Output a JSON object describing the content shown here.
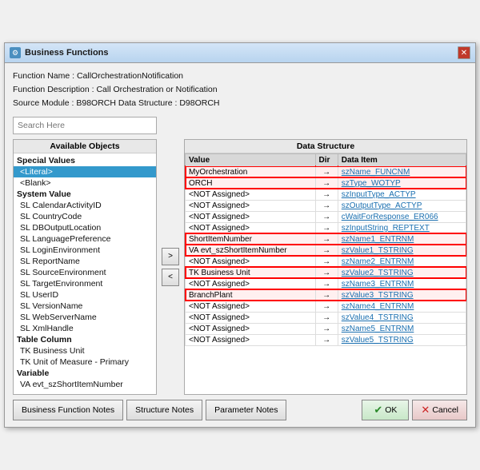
{
  "window": {
    "title": "Business Functions",
    "close_label": "✕"
  },
  "info": {
    "function_name_label": "Function Name : CallOrchestrationNotification",
    "function_desc_label": "Function Description : Call Orchestration or Notification",
    "source_module_label": "Source Module : B98ORCH    Data Structure : D98ORCH"
  },
  "search": {
    "placeholder": "Search Here"
  },
  "available_objects": {
    "header": "Available Objects",
    "sections": [
      {
        "label": "Special Values",
        "items": [
          {
            "text": "<Literal>",
            "selected": true
          },
          {
            "text": "<Blank>",
            "selected": false
          }
        ]
      },
      {
        "label": "System Value",
        "items": [
          {
            "text": "SL  CalendarActivityID",
            "selected": false
          },
          {
            "text": "SL  CountryCode",
            "selected": false
          },
          {
            "text": "SL  DBOutputLocation",
            "selected": false
          },
          {
            "text": "SL  LanguagePreference",
            "selected": false
          },
          {
            "text": "SL  LoginEnvironment",
            "selected": false
          },
          {
            "text": "SL  ReportName",
            "selected": false
          },
          {
            "text": "SL  SourceEnvironment",
            "selected": false
          },
          {
            "text": "SL  TargetEnvironment",
            "selected": false
          },
          {
            "text": "SL  UserID",
            "selected": false
          },
          {
            "text": "SL  VersionName",
            "selected": false
          },
          {
            "text": "SL  WebServerName",
            "selected": false
          },
          {
            "text": "SL  XmlHandle",
            "selected": false
          }
        ]
      },
      {
        "label": "Table Column",
        "items": [
          {
            "text": "TK  Business Unit",
            "selected": false
          },
          {
            "text": "TK  Unit of Measure - Primary",
            "selected": false
          }
        ]
      },
      {
        "label": "Variable",
        "items": [
          {
            "text": "VA  evt_szShortItemNumber",
            "selected": false
          }
        ]
      }
    ]
  },
  "middle_buttons": {
    "right_arrow": ">",
    "left_arrow": "<"
  },
  "data_structure": {
    "header": "Data Structure",
    "columns": [
      "Value",
      "Dir",
      "Data Item"
    ],
    "rows": [
      {
        "value": "MyOrchestration",
        "dir": "→",
        "data_item": "szName_FUNCNM",
        "highlighted": true
      },
      {
        "value": "ORCH",
        "dir": "→",
        "data_item": "szType_WOTYP",
        "highlighted": true
      },
      {
        "value": "<NOT Assigned>",
        "dir": "→",
        "data_item": "szInputType_ACTYP",
        "highlighted": false
      },
      {
        "value": "<NOT Assigned>",
        "dir": "→",
        "data_item": "szOutputType_ACTYP",
        "highlighted": false
      },
      {
        "value": "<NOT Assigned>",
        "dir": "→",
        "data_item": "cWaitForResponse_ER066",
        "highlighted": false
      },
      {
        "value": "<NOT Assigned>",
        "dir": "→",
        "data_item": "szInputString_REPTEXT",
        "highlighted": false
      },
      {
        "value": "ShortItemNumber",
        "dir": "→",
        "data_item": "szName1_ENTRNM",
        "highlighted": true
      },
      {
        "value": "VA  evt_szShortItemNumber",
        "dir": "→",
        "data_item": "szValue1_TSTRING",
        "highlighted": true
      },
      {
        "value": "<NOT Assigned>",
        "dir": "→",
        "data_item": "szName2_ENTRNM",
        "highlighted": false
      },
      {
        "value": "TK  Business Unit",
        "dir": "→",
        "data_item": "szValue2_TSTRING",
        "highlighted": true
      },
      {
        "value": "<NOT Assigned>",
        "dir": "→",
        "data_item": "szName3_ENTRNM",
        "highlighted": false
      },
      {
        "value": "BranchPlant",
        "dir": "→",
        "data_item": "szValue3_TSTRING",
        "highlighted": true
      },
      {
        "value": "<NOT Assigned>",
        "dir": "→",
        "data_item": "szName4_ENTRNM",
        "highlighted": false
      },
      {
        "value": "<NOT Assigned>",
        "dir": "→",
        "data_item": "szValue4_TSTRING",
        "highlighted": false
      },
      {
        "value": "<NOT Assigned>",
        "dir": "→",
        "data_item": "szName5_ENTRNM",
        "highlighted": false
      },
      {
        "value": "<NOT Assigned>",
        "dir": "→",
        "data_item": "szValue5_TSTRING",
        "highlighted": false
      }
    ]
  },
  "footer": {
    "business_function_notes": "Business Function Notes",
    "structure_notes": "Structure Notes",
    "parameter_notes": "Parameter Notes",
    "ok_label": "OK",
    "cancel_label": "Cancel"
  }
}
